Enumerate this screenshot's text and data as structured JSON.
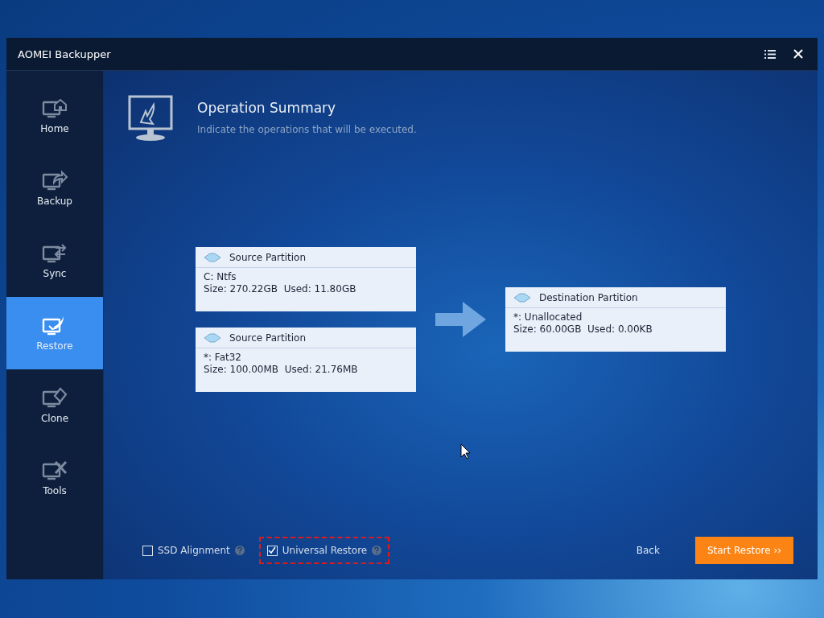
{
  "window": {
    "title": "AOMEI Backupper"
  },
  "sidebar": {
    "items": [
      {
        "label": "Home",
        "kind": "home",
        "selected": false
      },
      {
        "label": "Backup",
        "kind": "backup",
        "selected": false
      },
      {
        "label": "Sync",
        "kind": "sync",
        "selected": false
      },
      {
        "label": "Restore",
        "kind": "restore",
        "selected": true
      },
      {
        "label": "Clone",
        "kind": "clone",
        "selected": false
      },
      {
        "label": "Tools",
        "kind": "tools",
        "selected": false
      }
    ]
  },
  "header": {
    "title": "Operation Summary",
    "subtitle": "Indicate the operations that will be executed."
  },
  "sources": [
    {
      "title": "Source Partition",
      "name": "C: Ntfs",
      "size": "Size: 270.22GB  Used: 11.80GB"
    },
    {
      "title": "Source Partition",
      "name": "*: Fat32",
      "size": "Size: 100.00MB  Used: 21.76MB"
    }
  ],
  "destination": {
    "title": "Destination Partition",
    "name": "*: Unallocated",
    "size": "Size: 60.00GB  Used: 0.00KB"
  },
  "options": [
    {
      "label": "SSD Alignment",
      "checked": false,
      "highlighted": false
    },
    {
      "label": "Universal Restore",
      "checked": true,
      "highlighted": true
    }
  ],
  "buttons": {
    "back": "Back",
    "start": "Start Restore ››"
  }
}
